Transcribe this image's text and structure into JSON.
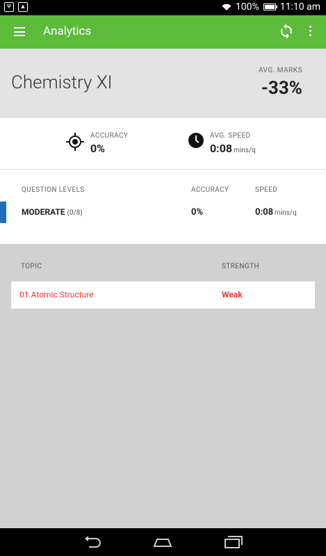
{
  "status_bar": {
    "battery": "100%",
    "time": "11:10",
    "ampm": "am",
    "notification_icons": [
      "usb-icon",
      "image-icon"
    ]
  },
  "app_bar": {
    "title": "Analytics",
    "color": "#5dba3b"
  },
  "summary": {
    "course": "Chemistry XI",
    "avg_marks_label": "AVG. MARKS",
    "avg_marks_value": "-33%"
  },
  "stats": {
    "accuracy_label": "ACCURACY",
    "accuracy_value": "0%",
    "speed_label": "AVG. SPEED",
    "speed_value": "0:08",
    "speed_unit": "mins/q"
  },
  "question_levels": {
    "headers": {
      "level": "QUESTION LEVELS",
      "accuracy": "ACCURACY",
      "speed": "SPEED"
    },
    "rows": [
      {
        "name": "MODERATE",
        "count": "(0/8)",
        "accuracy": "0%",
        "speed": "0:08",
        "speed_unit": "mins/q",
        "color": "#1e6fb8"
      }
    ]
  },
  "topics": {
    "headers": {
      "topic": "TOPIC",
      "strength": "STRENGTH"
    },
    "rows": [
      {
        "name": "01.Atomic Structure",
        "strength": "Weak",
        "color": "#e53935"
      }
    ]
  }
}
